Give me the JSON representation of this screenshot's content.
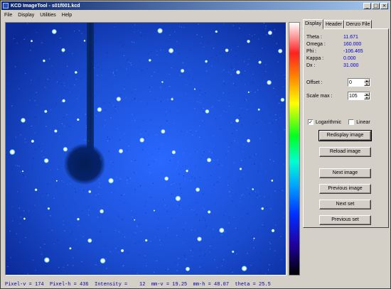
{
  "window": {
    "title": "KCD ImageTool - s01f001.kcd",
    "minimize_glyph": "_",
    "maximize_glyph": "□",
    "close_glyph": "×"
  },
  "menu": [
    "File",
    "Display",
    "Utilities",
    "Help"
  ],
  "tabs": [
    "Display",
    "Header",
    "Denzo File"
  ],
  "params": [
    {
      "key": "Theta :",
      "value": "11.671"
    },
    {
      "key": "Omega :",
      "value": "160.000"
    },
    {
      "key": "Phi :",
      "value": "-106.465"
    },
    {
      "key": "Kappa :",
      "value": "0.000"
    },
    {
      "key": "Dx :",
      "value": "31.000"
    }
  ],
  "offset": {
    "label": "Offset :",
    "value": "0"
  },
  "scale_max": {
    "label": "Scale max :",
    "value": "105"
  },
  "logarithmic": {
    "label": "Logarithmic",
    "checked": true
  },
  "linear": {
    "label": "Linear",
    "checked": false
  },
  "buttons": {
    "redisplay": "Redisplay image",
    "reload": "Reload image",
    "next_image": "Next image",
    "previous_image": "Previous image",
    "next_set": "Next set",
    "previous_set": "Previous set"
  },
  "status": "Pixel-v = 174  Pixel-h = 436  Intensity =    12  mm-v = 19.25  mm-h = 48.07  theta = 25.5",
  "colors": {
    "image_background": "#1a4cd0",
    "param_value": "#0000c8",
    "status_text": "#0000a0"
  }
}
